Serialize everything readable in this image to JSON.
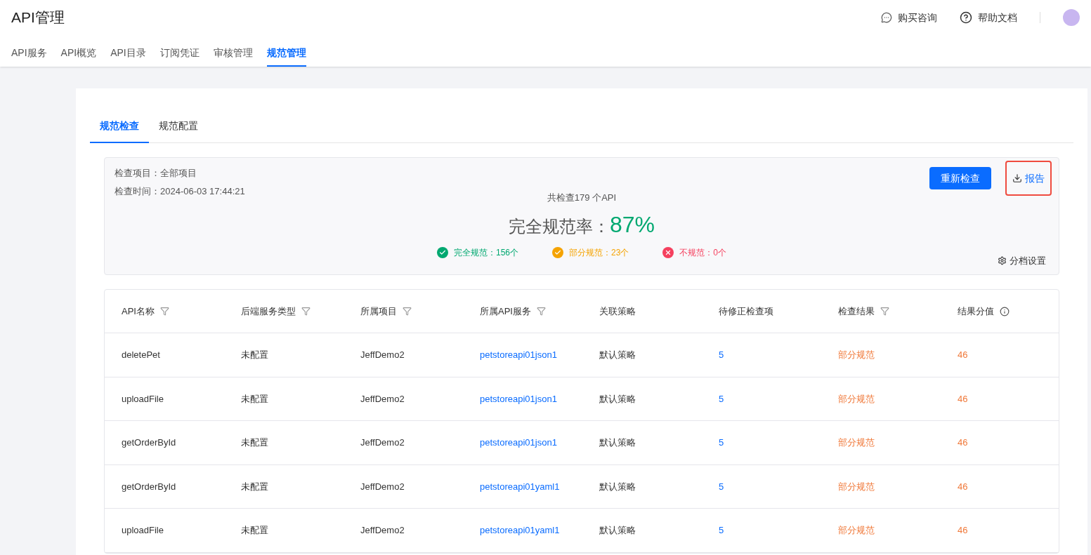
{
  "app_title": "API管理",
  "header_links": [
    {
      "kind": "chat",
      "label": "购买咨询"
    },
    {
      "kind": "help",
      "label": "帮助文档"
    }
  ],
  "nav_tabs": [
    {
      "label": "API服务",
      "selected": false
    },
    {
      "label": "API概览",
      "selected": false
    },
    {
      "label": "API目录",
      "selected": false
    },
    {
      "label": "订阅凭证",
      "selected": false
    },
    {
      "label": "审核管理",
      "selected": false
    },
    {
      "label": "规范管理",
      "selected": true
    }
  ],
  "sub_tabs": [
    {
      "label": "规范检查",
      "selected": true
    },
    {
      "label": "规范配置",
      "selected": false
    }
  ],
  "summary": {
    "project": "检查项目：全部项目",
    "time": "检查时间：2024-06-03 17:44:21",
    "total": "共检查179 个API",
    "rate_label": "完全规范率：",
    "rate_value": "87%",
    "stats": [
      {
        "kind": "ok",
        "label": "完全规范：156个"
      },
      {
        "kind": "partial",
        "label": "部分规范：23个"
      },
      {
        "kind": "fail",
        "label": "不规范：0个"
      }
    ],
    "recheck_button": "重新检查",
    "report_button": {
      "label": "报告",
      "highlighted": true
    },
    "settings_link": "分档设置"
  },
  "table": {
    "columns": [
      {
        "label": "API名称",
        "kind": "filter"
      },
      {
        "label": "后端服务类型",
        "kind": "filter"
      },
      {
        "label": "所属项目",
        "kind": "filter"
      },
      {
        "label": "所属API服务",
        "kind": "filter"
      },
      {
        "label": "关联策略",
        "kind": "plain"
      },
      {
        "label": "待修正检查项",
        "kind": "plain"
      },
      {
        "label": "检查结果",
        "kind": "filter"
      },
      {
        "label": "结果分值",
        "kind": "info"
      }
    ],
    "rows": [
      {
        "name": "deletePet",
        "backend": "未配置",
        "project": "JeffDemo2",
        "service": "petstoreapi01json1",
        "policy": "默认策略",
        "pending": "5",
        "result": {
          "kind": "partial",
          "label": "部分规范"
        },
        "score": "46"
      },
      {
        "name": "uploadFile",
        "backend": "未配置",
        "project": "JeffDemo2",
        "service": "petstoreapi01json1",
        "policy": "默认策略",
        "pending": "5",
        "result": {
          "kind": "partial",
          "label": "部分规范"
        },
        "score": "46"
      },
      {
        "name": "getOrderById",
        "backend": "未配置",
        "project": "JeffDemo2",
        "service": "petstoreapi01json1",
        "policy": "默认策略",
        "pending": "5",
        "result": {
          "kind": "partial",
          "label": "部分规范"
        },
        "score": "46"
      },
      {
        "name": "getOrderById",
        "backend": "未配置",
        "project": "JeffDemo2",
        "service": "petstoreapi01yaml1",
        "policy": "默认策略",
        "pending": "5",
        "result": {
          "kind": "partial",
          "label": "部分规范"
        },
        "score": "46"
      },
      {
        "name": "uploadFile",
        "backend": "未配置",
        "project": "JeffDemo2",
        "service": "petstoreapi01yaml1",
        "policy": "默认策略",
        "pending": "5",
        "result": {
          "kind": "partial",
          "label": "部分规范"
        },
        "score": "46"
      }
    ]
  }
}
